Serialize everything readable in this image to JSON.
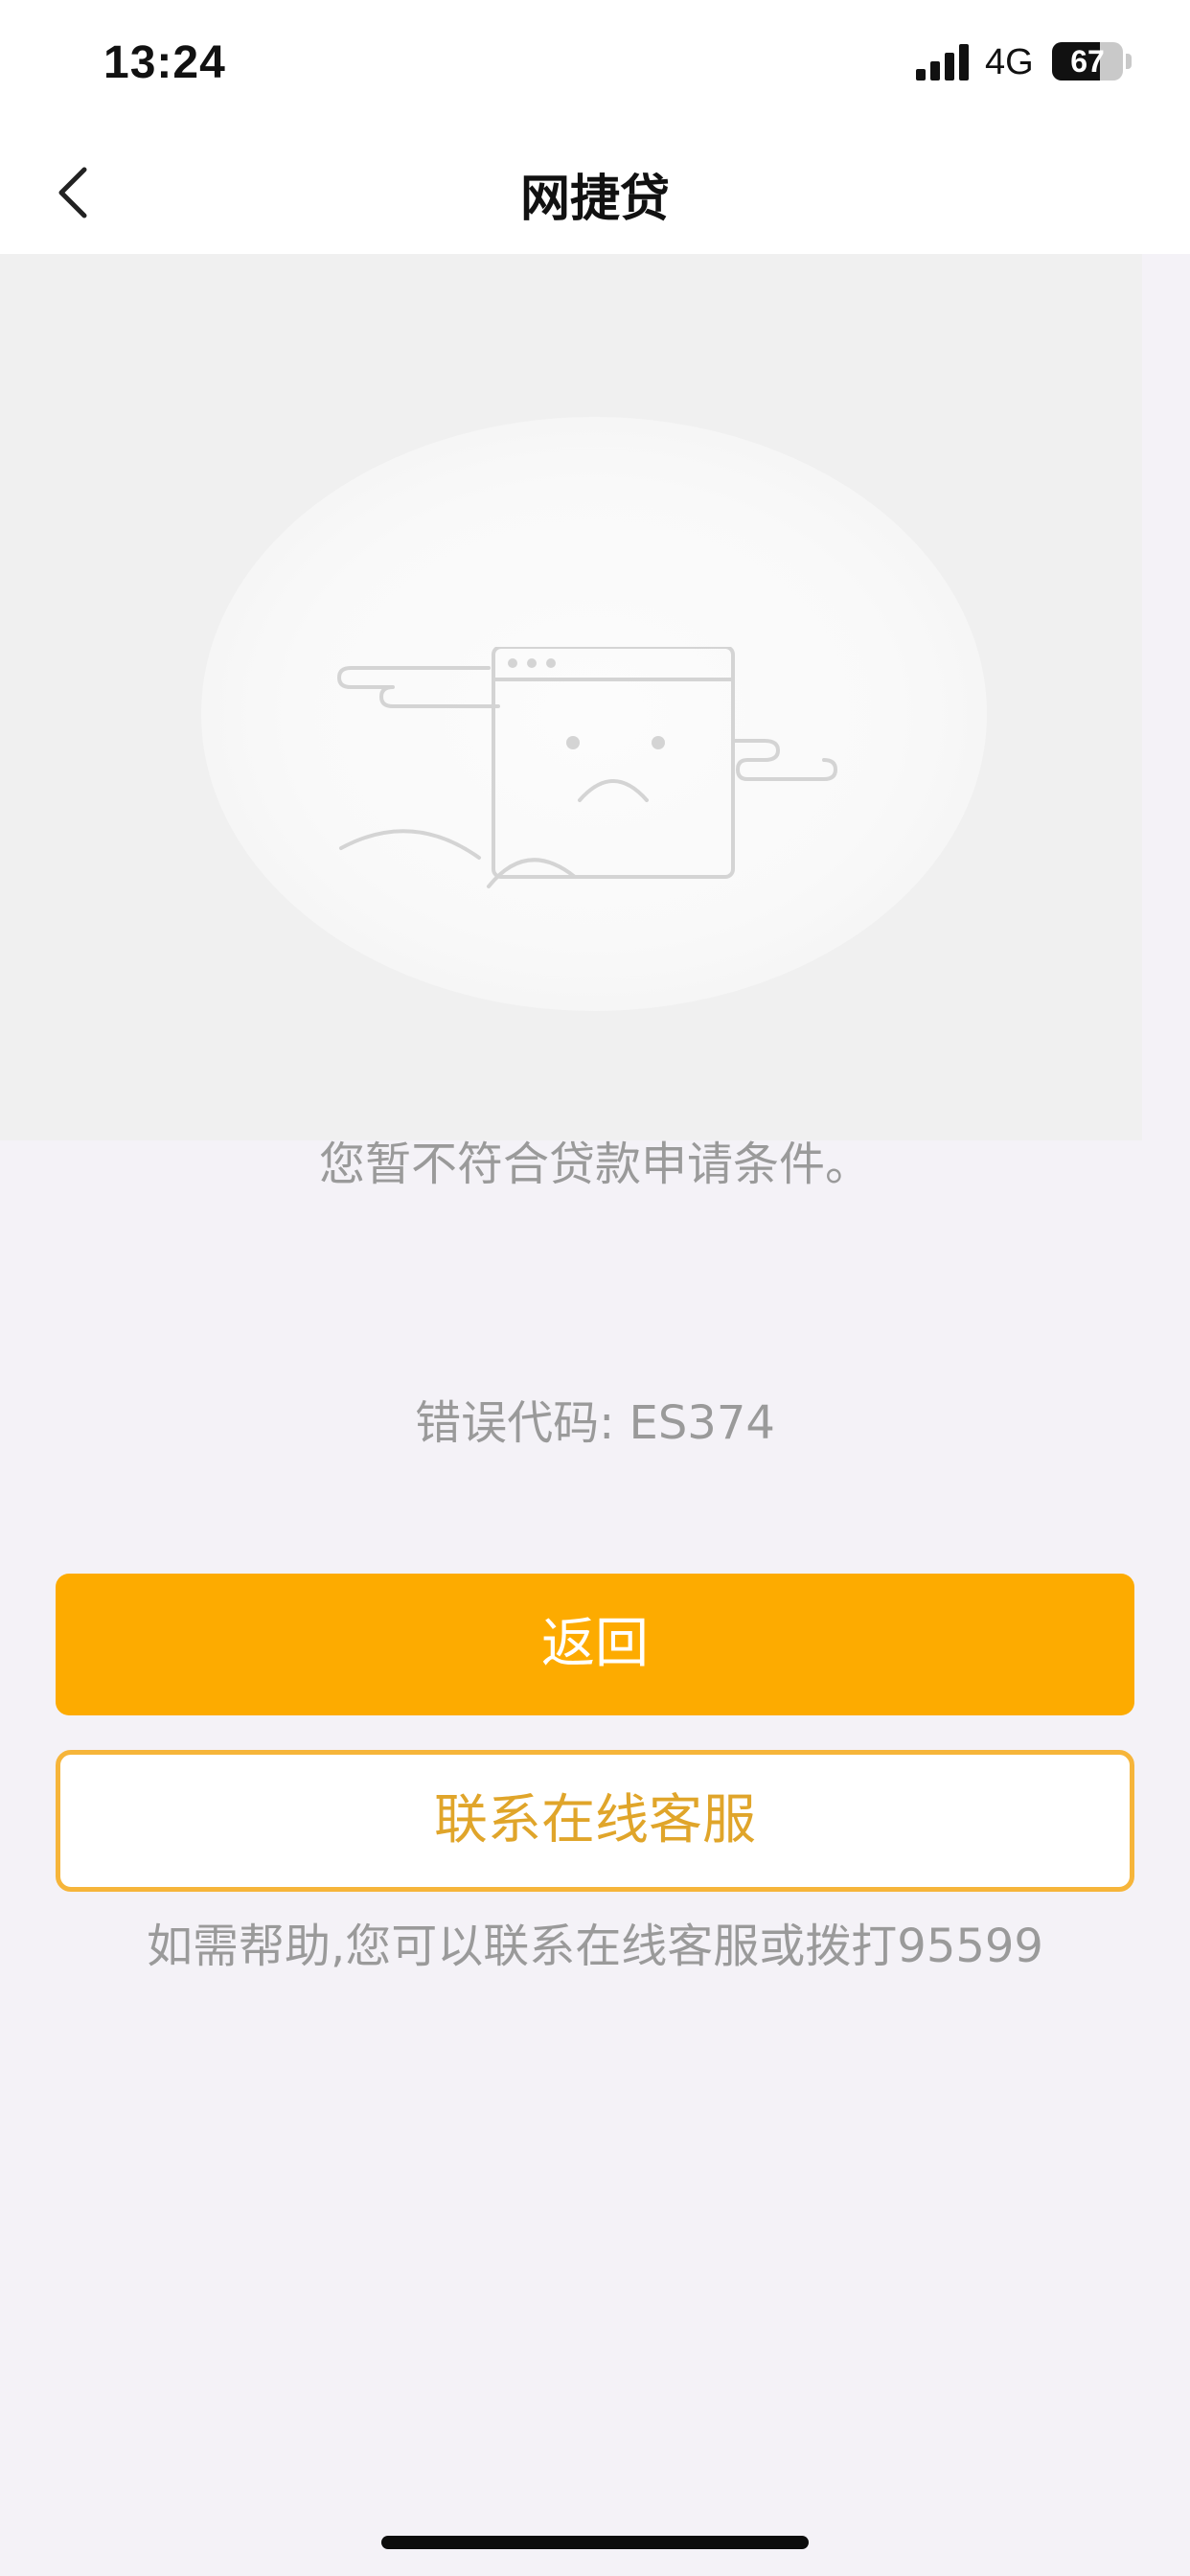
{
  "status_bar": {
    "time": "13:24",
    "network": "4G",
    "battery": "67",
    "battery_level": 0.67
  },
  "nav": {
    "title": "网捷贷"
  },
  "content": {
    "message": "您暂不符合贷款申请条件。",
    "error_code": "错误代码: ES374"
  },
  "actions": {
    "return_label": "返回",
    "service_label": "联系在线客服"
  },
  "help": {
    "text": "如需帮助,您可以联系在线客服或拨打95599"
  },
  "colors": {
    "primary": "#fdab00",
    "outline": "#f6b53a",
    "muted_text": "#9a9a9a",
    "background": "#f4f2f7"
  }
}
